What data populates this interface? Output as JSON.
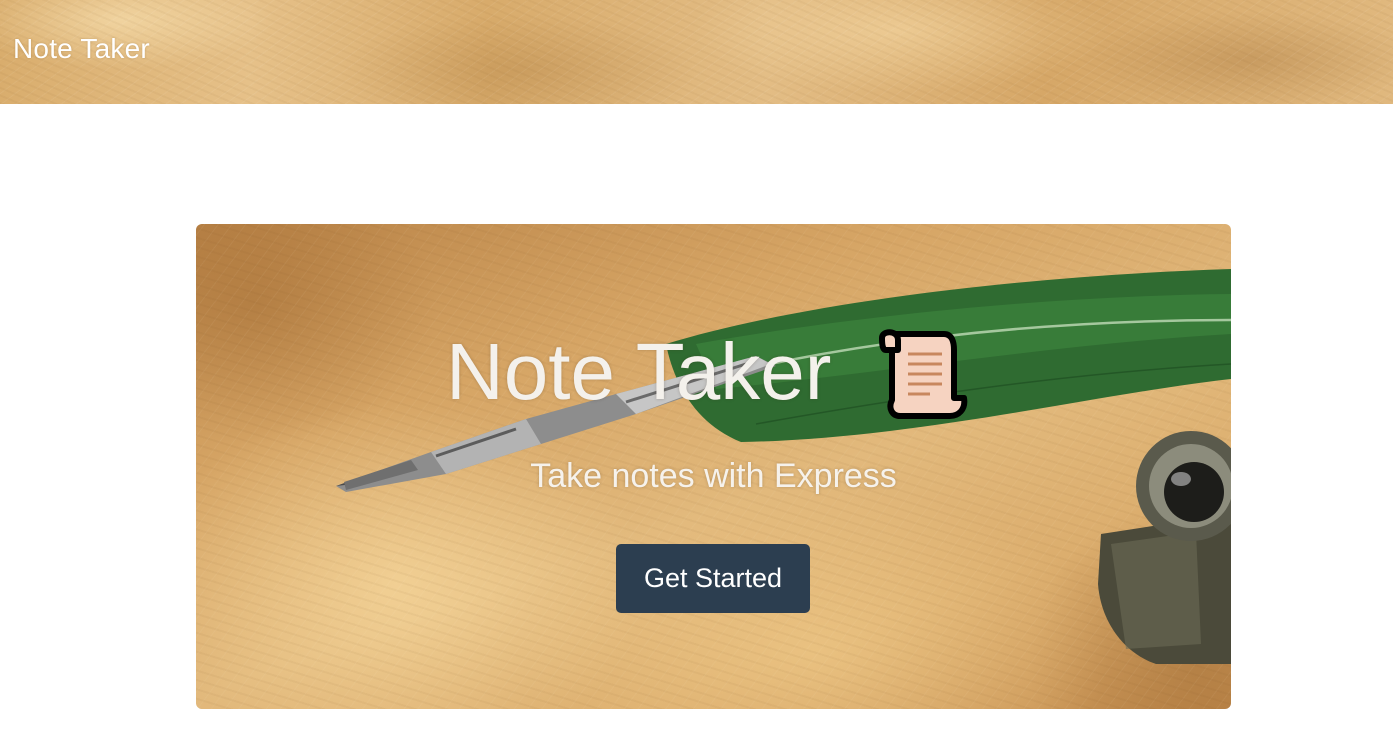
{
  "navbar": {
    "brand": "Note Taker"
  },
  "hero": {
    "title": "Note Taker",
    "title_icon": "scroll-icon",
    "subtitle": "Take notes with Express",
    "button_label": "Get Started",
    "background_image": "quill-pen-and-inkwell-on-parchment"
  },
  "colors": {
    "button_bg": "#2c3e50",
    "text_light": "#ffffff",
    "parchment": "#dcae6e",
    "feather_green": "#2f7a36"
  }
}
